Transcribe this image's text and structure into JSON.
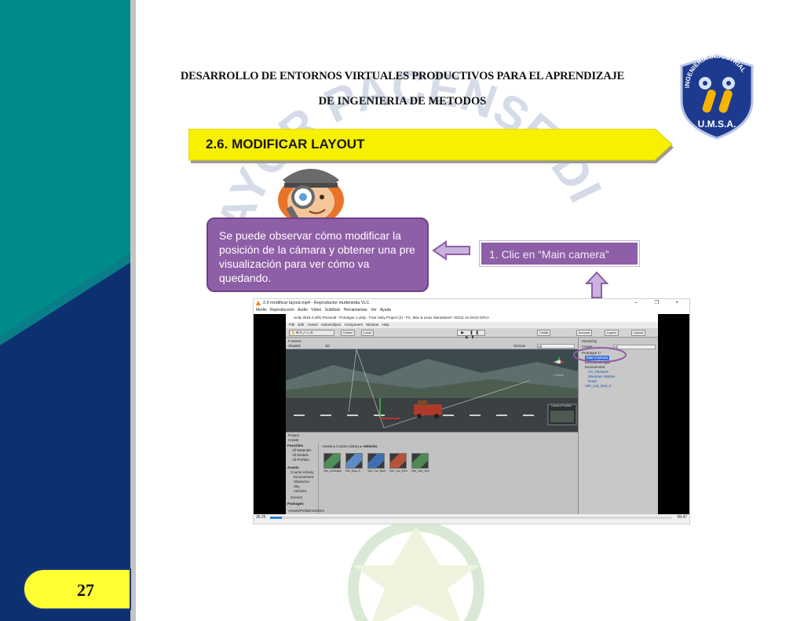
{
  "header": {
    "line1": "DESARROLLO DE ENTORNOS VIRTUALES PRODUCTIVOS PARA EL APRENDIZAJE",
    "line2": "DE INGENIERIA DE METODOS"
  },
  "logo": {
    "arc_text": "INGENIERIA INDUSTRIAL",
    "bottom_text": "U.M.S.A."
  },
  "watermark": {
    "text": "MAYOR PACENSE DIV"
  },
  "section": {
    "title": "2.6. MODIFICAR LAYOUT"
  },
  "callout": {
    "text": "Se puede observar cómo modificar la posición de la cámara y obtener una pre visualización para ver cómo va quedando."
  },
  "step": {
    "label": "1. Clic en “Main camera”"
  },
  "vlc": {
    "title": "2.6 modificar layout.mp4 - Reproductor multimedia VLC",
    "window_controls": "– ❐ ×",
    "menu": [
      "Medio",
      "Reproducción",
      "Audio",
      "Vídeo",
      "Subtítulo",
      "Herramientas",
      "Ver",
      "Ayuda"
    ],
    "time_elapsed": "36:25",
    "time_total": "05:47",
    "progress": 0.03
  },
  "unity": {
    "title": "Unity 2018.4.28f1 Personal - Prototype 1.unity - Fran Unity Project (3) - PC, Mac & Linux Standalone* <DX11 on DX10 GPU>",
    "menu": [
      "File",
      "Edit",
      "Assets",
      "GameObject",
      "Component",
      "Window",
      "Help"
    ],
    "toolbar": {
      "center": "Center",
      "local": "Local",
      "collab": "Collab",
      "account": "Account",
      "layers": "Layers",
      "layout": "Layout",
      "play": "▶ ❚❚ ▶❚"
    },
    "scene_tabs": {
      "scene": "# Scene",
      "shaded": "Shaded",
      "mode_2d": "2D",
      "gizmos": "Gizmos",
      "search": "All"
    },
    "scene_persp": "< Persp",
    "camera_preview_label": "Camera Preview",
    "hierarchy": {
      "tab": "Hierarchy",
      "create": "Create",
      "search": "All",
      "items": [
        {
          "label": "Prototype 1*",
          "indent": 0
        },
        {
          "label": "Main Camera",
          "indent": 1
        },
        {
          "label": "Directional Light",
          "indent": 1
        },
        {
          "label": "Environment",
          "indent": 1
        },
        {
          "label": "Art_Obstacle",
          "indent": 2
        },
        {
          "label": "Mountain Skybox",
          "indent": 2
        },
        {
          "label": "Road",
          "indent": 2
        },
        {
          "label": "Veh_Car_Red_Z",
          "indent": 1
        }
      ]
    },
    "project": {
      "tab": "Project",
      "create": "Create",
      "favorites_header": "Favorites",
      "favorites": [
        "All Materials",
        "All Models",
        "All Prefabs"
      ],
      "assets_header": "Assets",
      "asset_tree": [
        "Course Library",
        "Environment",
        "Obstacles",
        "Sky",
        "Vehicles",
        "Scenes"
      ],
      "packages": "Packages",
      "breadcrumb": [
        "Assets",
        "Course Library",
        "Vehicles"
      ],
      "assets": [
        {
          "label": "Veh_Ambulance",
          "color": "#4c8f5a"
        },
        {
          "label": "Veh_Bus_B",
          "color": "#5b8cc4"
        },
        {
          "label": "Veh_Car_Blue",
          "color": "#3f6fb0"
        },
        {
          "label": "Veh_Car_Red",
          "color": "#b4553a"
        },
        {
          "label": "Veh_Van_Green",
          "color": "#4f8a56"
        }
      ],
      "footer": "Assets/Prefab/Vehicles"
    }
  },
  "page_number": "27",
  "colors": {
    "teal": "#008b8b",
    "navy": "#0d3070",
    "banner_yellow": "#f7f000",
    "callout_purple": "#8e5ea6",
    "badge_yellow": "#ffff33"
  }
}
